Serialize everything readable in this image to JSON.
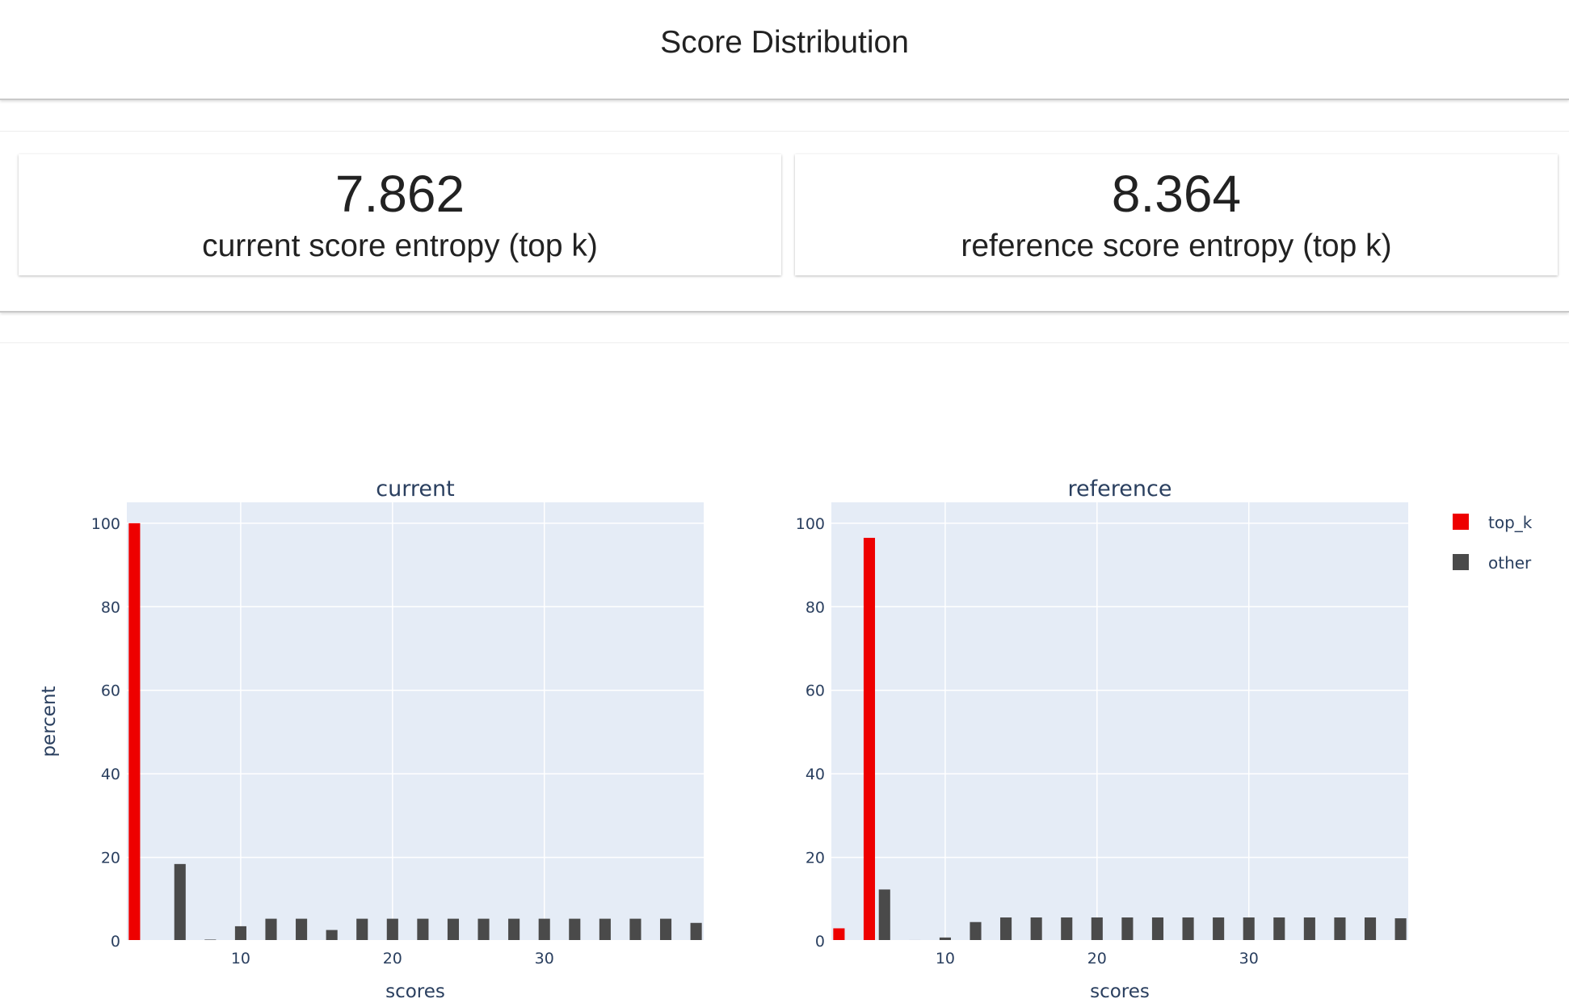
{
  "header": {
    "title": "Score Distribution"
  },
  "metrics": [
    {
      "value": "7.862",
      "label": "current score entropy (top k)"
    },
    {
      "value": "8.364",
      "label": "reference score entropy (top k)"
    }
  ],
  "colors": {
    "top_k": "#ee0000",
    "other": "#4a4a4a",
    "plot_bg": "#e5ecf6",
    "grid": "#ffffff",
    "text": "#2a3f5f"
  },
  "chart_data": [
    {
      "type": "bar",
      "title": "current",
      "xlabel": "scores",
      "ylabel": "percent",
      "xlim": [
        2.5,
        40.5
      ],
      "ylim": [
        0,
        105
      ],
      "xticks": [
        10,
        20,
        30
      ],
      "yticks": [
        0,
        20,
        40,
        60,
        80,
        100
      ],
      "grid": true,
      "series": [
        {
          "name": "top_k",
          "color": "#ee0000",
          "x": [
            3
          ],
          "values": [
            100
          ]
        },
        {
          "name": "other",
          "color": "#4a4a4a",
          "x": [
            4,
            6,
            8,
            10,
            12,
            14,
            16,
            18,
            20,
            22,
            24,
            26,
            28,
            30,
            32,
            34,
            36,
            38,
            40
          ],
          "values": [
            0.1,
            18.4,
            0.3,
            3.5,
            5.3,
            5.3,
            2.6,
            5.3,
            5.3,
            5.3,
            5.3,
            5.3,
            5.3,
            5.3,
            5.3,
            5.3,
            5.3,
            5.3,
            4.3
          ]
        }
      ]
    },
    {
      "type": "bar",
      "title": "reference",
      "xlabel": "scores",
      "ylabel": "",
      "xlim": [
        2.5,
        40.5
      ],
      "ylim": [
        0,
        105
      ],
      "xticks": [
        10,
        20,
        30
      ],
      "yticks": [
        0,
        20,
        40,
        60,
        80,
        100
      ],
      "grid": true,
      "series": [
        {
          "name": "top_k",
          "color": "#ee0000",
          "x": [
            3,
            5
          ],
          "values": [
            3,
            96.5
          ]
        },
        {
          "name": "other",
          "color": "#4a4a4a",
          "x": [
            6,
            8,
            10,
            12,
            14,
            16,
            18,
            20,
            22,
            24,
            26,
            28,
            30,
            32,
            34,
            36,
            38,
            40
          ],
          "values": [
            12.3,
            0.2,
            0.8,
            4.5,
            5.6,
            5.6,
            5.6,
            5.6,
            5.6,
            5.6,
            5.6,
            5.6,
            5.6,
            5.6,
            5.6,
            5.6,
            5.6,
            5.4
          ]
        }
      ]
    }
  ],
  "legend": {
    "placement": "top-right",
    "items": [
      {
        "name": "top_k",
        "color": "#ee0000"
      },
      {
        "name": "other",
        "color": "#4a4a4a"
      }
    ]
  }
}
